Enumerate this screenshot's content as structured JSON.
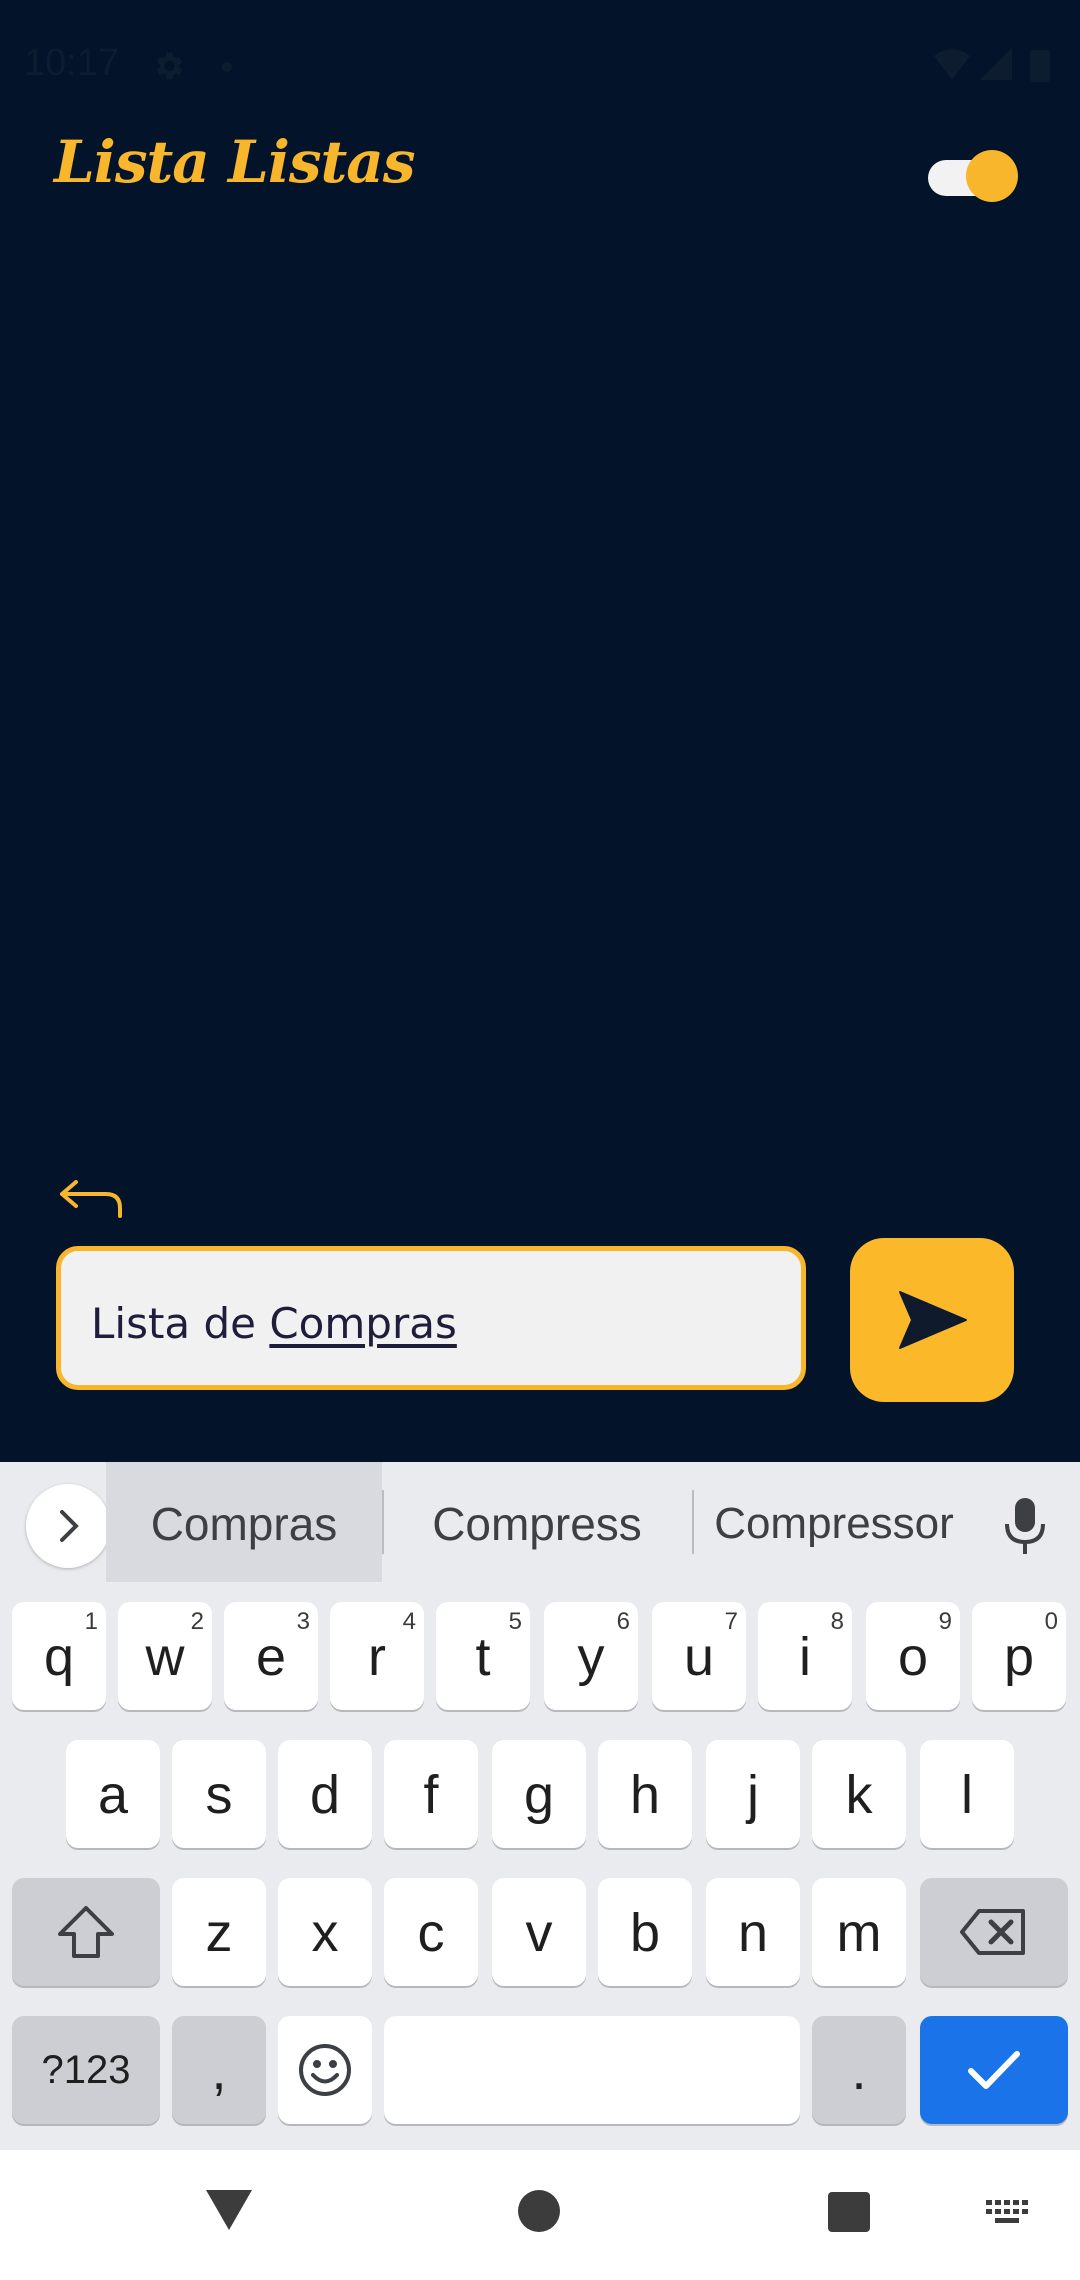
{
  "status": {
    "time": "10:17"
  },
  "app": {
    "title": "Lista Listas"
  },
  "input": {
    "prefix": "Lista de ",
    "composing": "Compras"
  },
  "colors": {
    "background": "#03142a",
    "accent": "#f7b62c",
    "enter_key": "#1a73e8"
  },
  "keyboard": {
    "suggestions": [
      "Compras",
      "Compress",
      "Compressor"
    ],
    "row1": [
      {
        "label": "q",
        "hint": "1"
      },
      {
        "label": "w",
        "hint": "2"
      },
      {
        "label": "e",
        "hint": "3"
      },
      {
        "label": "r",
        "hint": "4"
      },
      {
        "label": "t",
        "hint": "5"
      },
      {
        "label": "y",
        "hint": "6"
      },
      {
        "label": "u",
        "hint": "7"
      },
      {
        "label": "i",
        "hint": "8"
      },
      {
        "label": "o",
        "hint": "9"
      },
      {
        "label": "p",
        "hint": "0"
      }
    ],
    "row2": [
      "a",
      "s",
      "d",
      "f",
      "g",
      "h",
      "j",
      "k",
      "l"
    ],
    "row3": [
      "z",
      "x",
      "c",
      "v",
      "b",
      "n",
      "m"
    ],
    "symbols_label": "?123",
    "comma_label": ",",
    "period_label": "."
  }
}
